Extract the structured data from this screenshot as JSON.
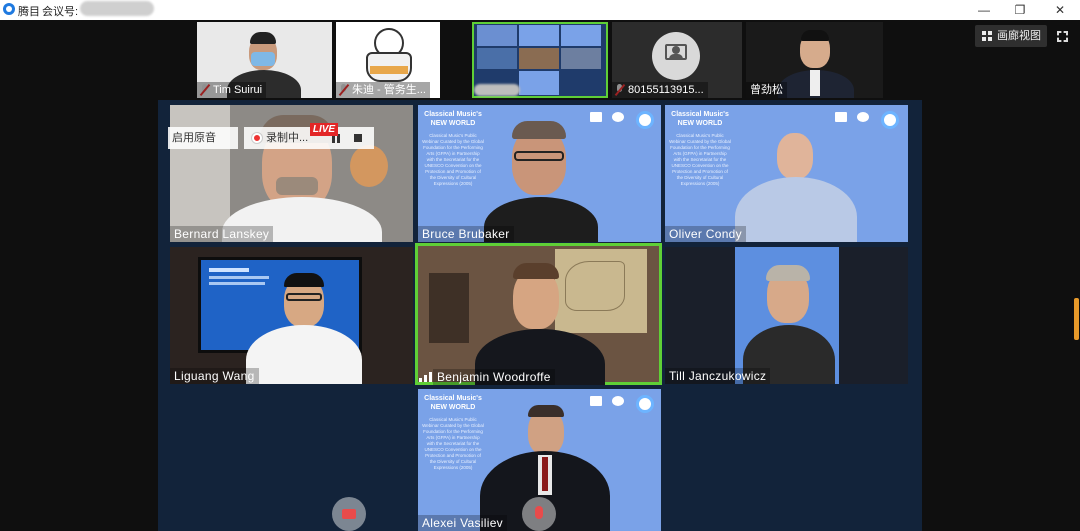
{
  "titlebar": {
    "app_name": "腾目",
    "meeting_label": "会议号: ",
    "minimize": "—",
    "maximize": "❐",
    "close": "✕"
  },
  "top_strip": {
    "participants": [
      {
        "name": "Tim Suirui",
        "muted": true
      },
      {
        "name": "朱迪 - 管务生...",
        "muted": true
      },
      {
        "name": "",
        "muted": false
      },
      {
        "name": "80155113915...",
        "muted": true
      },
      {
        "name": "曾劲松",
        "muted": false
      }
    ],
    "gallery_view_label": "画廊视图"
  },
  "gallery": {
    "tiles": [
      {
        "name": "Bernard  Lanskey"
      },
      {
        "name": "Bruce  Brubaker"
      },
      {
        "name": "Oliver  Condy"
      },
      {
        "name": "Liguang  Wang"
      },
      {
        "name": "Benjamin  Woodroffe",
        "speaking": true
      },
      {
        "name": "Till  Janczukowicz"
      },
      {
        "name": "Alexei  Vasiliev"
      }
    ],
    "poster": {
      "title_line1": "Classical Music's",
      "title_line2": "NEW WORLD",
      "body": "Classical Music's Public Webinar Curated by the Global Foundation for the Performing Arts (GFPA) in Partnership with the Secretariat for the UNESCO Convention on the Protection and Promotion of the Diversity of Cultural Expressions (2005)"
    }
  },
  "recording": {
    "original_sound_label": "启用原音",
    "recording_label": "录制中...",
    "live_label": "LIVE"
  },
  "colors": {
    "speaking_outline": "#5fcf36",
    "gallery_bg": "#12233a",
    "poster_blue": "#7aa2e8",
    "live_red": "#e32626"
  }
}
